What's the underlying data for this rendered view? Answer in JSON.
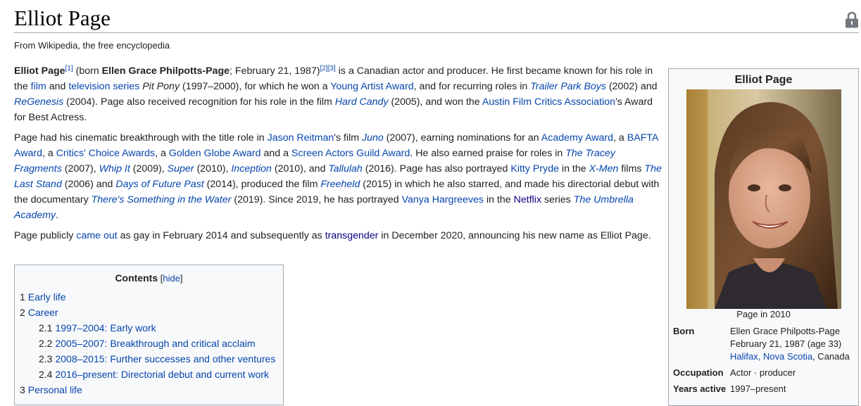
{
  "header": {
    "title": "Elliot Page",
    "tagline": "From Wikipedia, the free encyclopedia",
    "lock_icon": "lock-icon"
  },
  "lead": {
    "p1": {
      "name": "Elliot Page",
      "ref1": "[1]",
      "t1": " (born ",
      "birth_name": "Ellen Grace Philpotts-Page",
      "t2": "; February 21, 1987)",
      "ref2": "[2]",
      "ref3": "[3]",
      "t3": " is a Canadian actor and producer. He first became known for his role in the ",
      "l_film": "film",
      "t4": " and ",
      "l_tv": "television series",
      "t5": " ",
      "i_pitpony": "Pit Pony",
      "t6": " (1997–2000), for which he won a ",
      "l_yaa": "Young Artist Award",
      "t7": ", and for recurring roles in ",
      "l_tpb": "Trailer Park Boys",
      "t8": " (2002) and ",
      "l_regen": "ReGenesis",
      "t9": " (2004). Page also received recognition for his role in the film ",
      "l_hard": "Hard Candy",
      "t10": " (2005), and won the ",
      "l_afca": "Austin Film Critics Association",
      "t11": "'s Award for Best Actress."
    },
    "p2": {
      "t1": "Page had his cinematic breakthrough with the title role in ",
      "l_reitman": "Jason Reitman",
      "t2": "'s film ",
      "l_juno": "Juno",
      "t3": " (2007), earning nominations for an ",
      "l_academy": "Academy Award",
      "t4": ", a ",
      "l_bafta": "BAFTA Award",
      "t5": ", a ",
      "l_critics": "Critics' Choice Awards",
      "t6": ", a ",
      "l_globe": "Golden Globe Award",
      "t7": " and a ",
      "l_sag": "Screen Actors Guild Award",
      "t8": ". He also earned praise for roles in ",
      "l_tracey": "The Tracey Fragments",
      "t9": " (2007), ",
      "l_whip": "Whip It",
      "t10": " (2009), ",
      "l_super": "Super",
      "t11": " (2010), ",
      "l_inception": "Inception",
      "t12": " (2010), and ",
      "l_tallulah": "Tallulah",
      "t13": " (2016). Page has also portrayed ",
      "l_kitty": "Kitty Pryde",
      "t14": " in the ",
      "l_xmen": "X-Men",
      "t15": " films ",
      "l_laststand": "The Last Stand",
      "t16": " (2006) and ",
      "l_dofp": "Days of Future Past",
      "t17": " (2014), produced the film ",
      "l_freeheld": "Freeheld",
      "t18": " (2015) in which he also starred, and made his directorial debut with the documentary ",
      "l_water": "There's Something in the Water",
      "t19": " (2019). Since 2019, he has portrayed ",
      "l_vanya": "Vanya Hargreeves",
      "t20": " in the ",
      "l_netflix": "Netflix",
      "t21": " series ",
      "l_umbrella": "The Umbrella Academy",
      "t22": "."
    },
    "p3": {
      "t1": "Page publicly ",
      "l_cameout": "came out",
      "t2": " as gay in February 2014 and subsequently as ",
      "l_trans": "transgender",
      "t3": " in December 2020, announcing his new name as Elliot Page."
    }
  },
  "toc": {
    "title": "Contents",
    "bracket_open": " [",
    "hide": "hide",
    "bracket_close": "]",
    "items": [
      {
        "num": "1",
        "label": "Early life"
      },
      {
        "num": "2",
        "label": "Career"
      },
      {
        "num": "2.1",
        "label": "1997–2004: Early work"
      },
      {
        "num": "2.2",
        "label": "2005–2007: Breakthrough and critical acclaim"
      },
      {
        "num": "2.3",
        "label": "2008–2015: Further successes and other ventures"
      },
      {
        "num": "2.4",
        "label": "2016–present: Directorial debut and current work"
      },
      {
        "num": "3",
        "label": "Personal life"
      }
    ]
  },
  "infobox": {
    "title": "Elliot Page",
    "caption": "Page in 2010",
    "born_label": "Born",
    "born_name": "Ellen Grace Philpotts-Page",
    "born_date": "February 21, 1987 (age 33)",
    "born_city": "Halifax",
    "born_sep": ", ",
    "born_province": "Nova Scotia",
    "born_country": ", Canada",
    "occupation_label": "Occupation",
    "occupation_value": "Actor · producer",
    "years_label": "Years active",
    "years_value": "1997–present"
  }
}
